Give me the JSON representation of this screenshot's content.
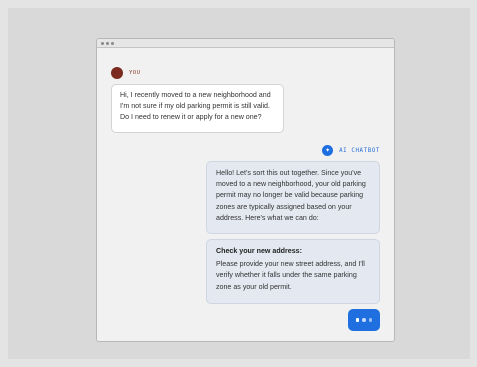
{
  "user": {
    "sender_label": "YOU",
    "message": "Hi, I recently moved to a new neighborhood and I'm not sure if my old parking permit is still valid. Do I need to renew it or apply for a new one?"
  },
  "bot": {
    "sender_label": "AI CHATBOT",
    "icon": "sparkle-icon",
    "message1": "Hello! Let's sort this out together. Since you've moved to a new neighborhood, your old parking permit may no longer be valid because parking zones are typically assigned based on your address. Here's what we can do:",
    "message2_title": "Check your new address:",
    "message2_body": "Please provide your new street address, and I'll verify whether it falls under the same parking zone as your old permit."
  },
  "colors": {
    "accent": "#1f6fe0",
    "user_avatar": "#7a2a1e",
    "bot_bubble": "#e3e8f1"
  }
}
